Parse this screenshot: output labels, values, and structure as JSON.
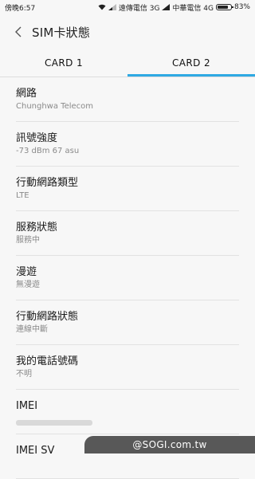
{
  "statusbar": {
    "time": "傍晚6:57",
    "carrier1": "遠傳電信 3G",
    "carrier2": "中華電信 4G",
    "battery": "83%",
    "battery_level": 0.83
  },
  "header": {
    "title": "SIM卡狀態"
  },
  "tabs": [
    {
      "label": "CARD 1"
    },
    {
      "label": "CARD 2"
    }
  ],
  "items": [
    {
      "label": "網路",
      "value": "Chunghwa Telecom"
    },
    {
      "label": "訊號強度",
      "value": "-73 dBm 67 asu"
    },
    {
      "label": "行動網路類型",
      "value": "LTE"
    },
    {
      "label": "服務狀態",
      "value": "服務中"
    },
    {
      "label": "漫遊",
      "value": "無漫遊"
    },
    {
      "label": "行動網路狀態",
      "value": "連線中斷"
    },
    {
      "label": "我的電話號碼",
      "value": "不明"
    },
    {
      "label": "IMEI"
    },
    {
      "label": "IMEI SV"
    }
  ],
  "watermark": "@SOGI.com.tw"
}
